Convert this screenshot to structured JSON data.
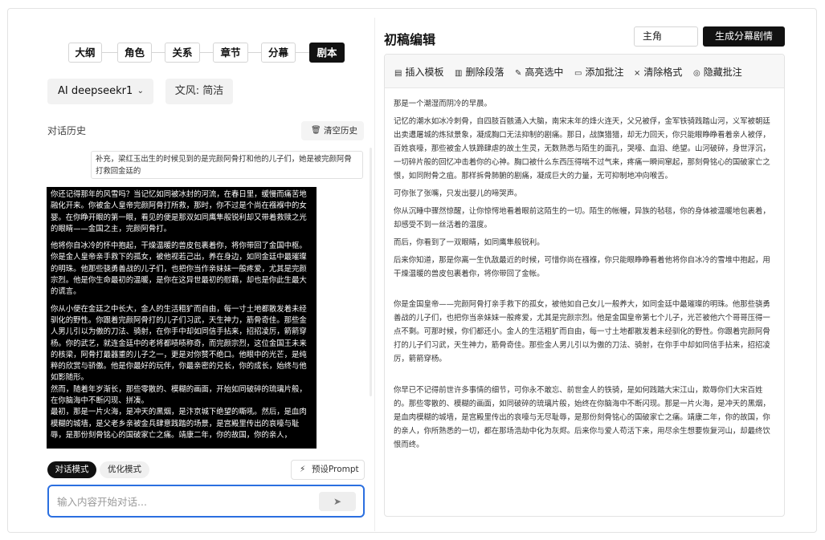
{
  "steps": [
    {
      "label": "大纲",
      "active": false
    },
    {
      "label": "角色",
      "active": false
    },
    {
      "label": "关系",
      "active": false
    },
    {
      "label": "章节",
      "active": false
    },
    {
      "label": "分幕",
      "active": false
    },
    {
      "label": "剧本",
      "active": true
    }
  ],
  "model": {
    "label": "AI  deepseekr1",
    "chevron_icon": "chevron-down-icon"
  },
  "style": {
    "label": "文风: 简洁"
  },
  "history": {
    "title": "对话历史",
    "clear_label": "清空历史",
    "clear_icon": "trash-icon"
  },
  "messages": {
    "user": "补充，梁红玉出生的时候见到的是完颜阿骨打和他的儿子们，她是被完颜阿骨打救回金廷的",
    "ai": [
      "你还记得那年的风雪吗？当记忆如同被冰封的河流，在春日里，缓慢而痛苦地融化开来。你被金人皇帝完颜阿骨打所救，那时，你不过是个尚在襁褓中的女婴。在你睁开眼的第一眼，看见的便是那双如同鹰隼般锐利却又带着救赎之光的眼睛——金国之主，完颜阿骨打。",
      "他将你自冰冷的怀中抱起，干燥温暖的兽皮包裹着你，将你带回了金国中枢。你是金人皇帝亲手救下的孤女，被他视若己出，养在身边，如同金廷中最璀璨的明珠。他那些骁勇善战的儿子们，也把你当作亲妹妹一般疼爱，尤其是完颜宗烈。他是你生命最初的温暖，是你在这异世最初的慰藉，却也是你此生最大的谎言。",
      "你从小便在金廷之中长大，金人的生活粗犷而自由，每一寸土地都散发着未经驯化的野性。你跟着完颜阿骨打的儿子们习武，天生神力，筋骨奇佳。那些金人男儿引以为傲的刀法、骑射，在你手中却如同信手拈来，招招凌厉，箭箭穿杨。你的武艺，就连金廷中的老将都啧啧称奇，而完颜宗烈，这位金国王未来的核梁，阿骨打最器重的儿子之一，更是对你赞不绝口。他眼中的光芒，是纯粹的欣赏与骄傲。他是你最好的玩伴，你最亲密的兄长，你的成长，始终与他如影随形。",
      "然而，随着年岁渐长，那些零散的、模糊的画面，开始如同破碎的琉璃片般，在你脑海中不断闪现、拼凑。",
      "最初，那是一片火海，是冲天的黑烟，是汴京城下绝望的嘶吼。然后，是血肉模糊的城墙，是父老乡亲被金兵肆意践踏的场景，是宫殿里传出的哀嚎与耻辱，是那份刻骨铭心的国破家亡之痛。靖康二年，你的故国，你的亲人，"
    ]
  },
  "modes": {
    "chat": "对话模式",
    "optimize": "优化模式",
    "preset": "预设Prompt",
    "preset_icon": "lightning-icon"
  },
  "input": {
    "placeholder": "输入内容开始对话...",
    "send_icon": "send-icon"
  },
  "editor": {
    "title": "初稿编辑",
    "role_value": "主角",
    "generate_label": "生成分幕剧情",
    "toolbar": [
      {
        "label": "插入模板",
        "icon": "template-icon"
      },
      {
        "label": "删除段落",
        "icon": "delete-paragraph-icon"
      },
      {
        "label": "高亮选中",
        "icon": "pen-icon"
      },
      {
        "label": "添加批注",
        "icon": "comment-icon"
      },
      {
        "label": "清除格式",
        "icon": "clear-format-icon"
      },
      {
        "label": "隐藏批注",
        "icon": "eye-icon"
      }
    ],
    "paragraphs": [
      "那是一个潮湿而阴冷的早晨。",
      "记忆的潮水如冰冷刺骨，自四肢百骸涌入大脑，南宋末年的烽火连天，父兄被俘，金军铁骑践踏山河，义军被朝廷出卖遭屠城的炼狱景象，凝成胸口无法抑制的剧痛。那日，战旗猎猎，却无力回天，你只能眼睁睁看着亲人被俘，百姓哀嚎，那些被金人铁蹄肆虐的故土生灵，无数熟悉与陌生的面孔，哭嚎、血泪、绝望。山河破碎，身世浮沉，一切碎片般的回忆冲击着你的心神。胸口被什么东西压得喘不过气来，疼痛一瞬间窜起，那刻骨铭心的国破家亡之恨，如同附骨之疽。那样拆骨肺腑的剧痛，凝成巨大的力量，无可抑制地冲向喉舌。",
      "可你张了张嘴，只发出婴儿的啼哭声。",
      "你从沉睡中骤然惊醒，让你惊愕地看着眼前这陌生的一切。陌生的帐幔，异族的毡毯，你的身体被温暖地包裹着，却感受不到一丝活着的温度。",
      "而后，你看到了一双眼睛，如同鹰隼般锐利。",
      "后来你知道，那是你离一生仇敌最近的时候，可惜你尚在襁褓，你只能眼睁睁看着他将你自冰冷的雪堆中抱起，用干燥温暖的兽皮包裹着你，将你带回了金帐。",
      "你是金国皇帝——完颜阿骨打亲手救下的孤女，被他如自己女儿一般养大，如同金廷中最璀璨的明珠。他那些骁勇善战的儿子们，也把你当亲妹妹一般疼爱，尤其是完颜宗烈。他是金国皇帝第七个儿子，光芒被他六个哥哥压得一点不剩。可那时候，你们都还小。金人的生活粗犷而自由，每一寸土地都散发着未经驯化的野性。你跟着完颜阿骨打的儿子们习武，天生神力，筋骨奇佳。那些金人男儿引以为傲的刀法、骑射，在你手中却如同信手拈来，招招凌厉，箭箭穿杨。",
      "你早已不记得前世许多事情的细节，可你永不敢忘、前世金人的铁骑，是如何践踏大宋江山，欺辱你们大宋百姓的。那些零散的、模糊的画面，如同破碎的琉璃片般，始终在你脑海中不断闪现。那是一片火海，是冲天的黑烟，是血肉模糊的城墙，是宫殿里传出的哀嚎与无尽耻辱，是那份刻骨铭心的国破家亡之痛。靖康二年，你的故国，你的亲人，你所熟悉的一切，都在那场浩劫中化为灰烬。后来你与爱人苟活下来，用尽余生想要恢复河山，却最终饮恨而终。"
    ]
  }
}
